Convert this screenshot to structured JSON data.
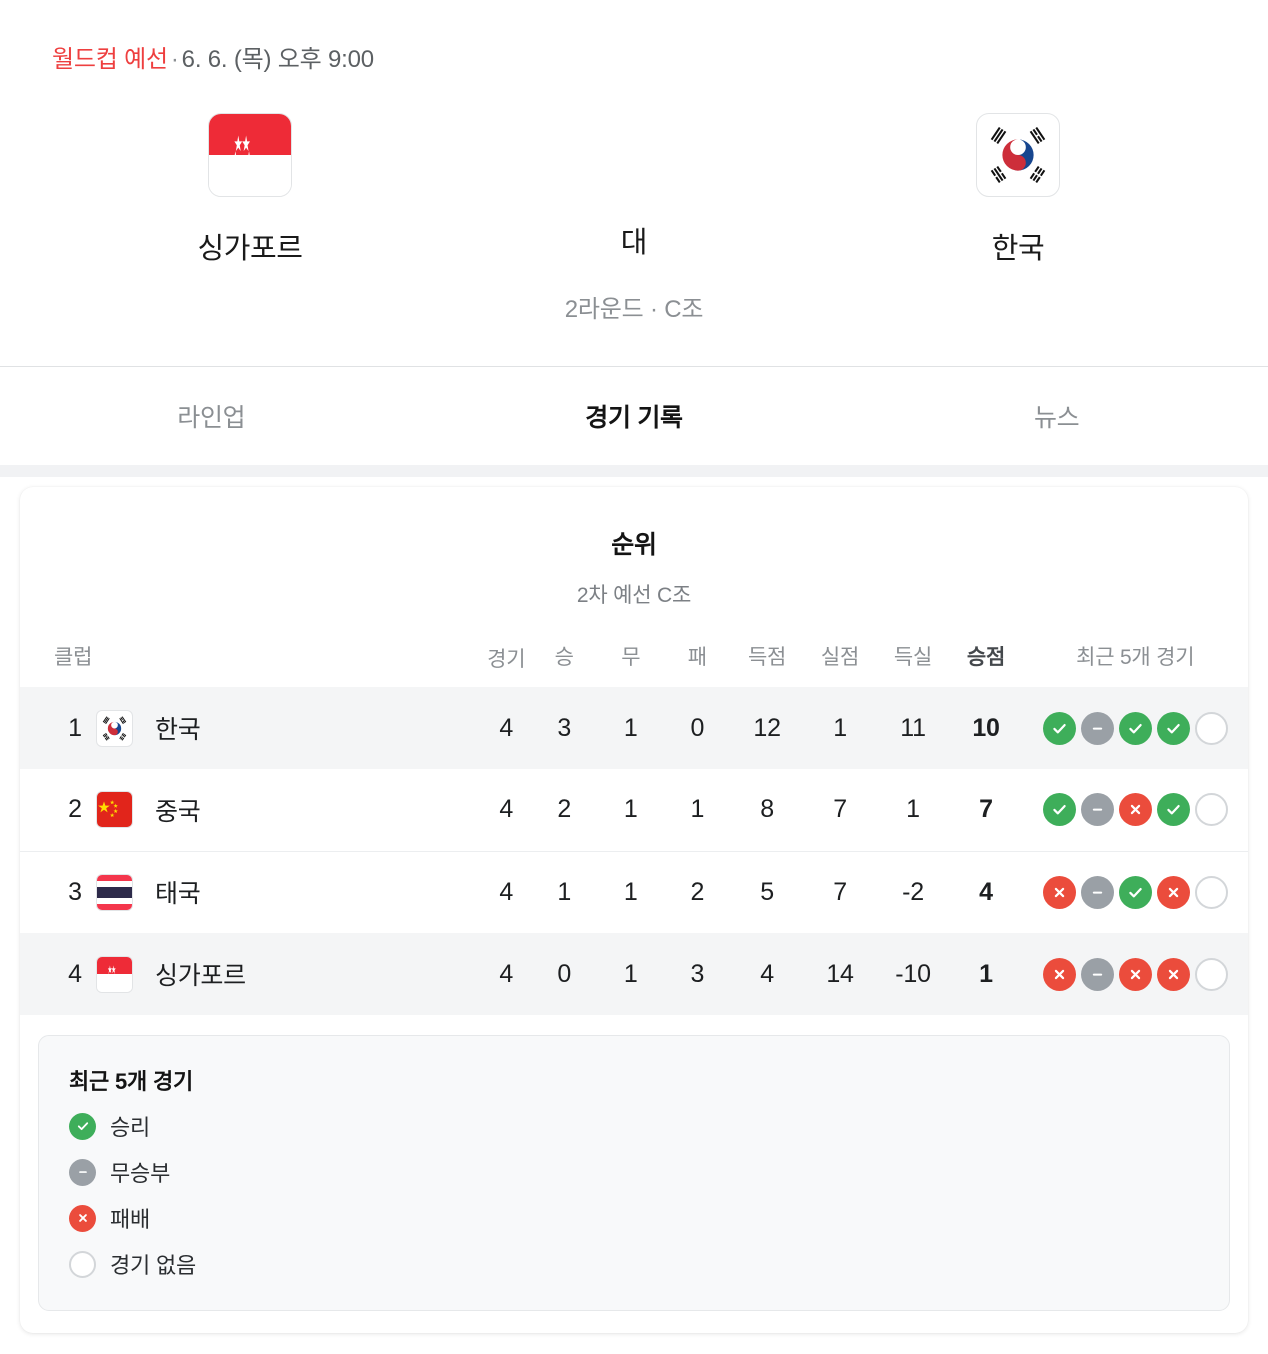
{
  "header": {
    "league": "월드컵 예선",
    "separator": "·",
    "datetime": "6. 6. (목) 오후 9:00",
    "home_team": "싱가포르",
    "away_team": "한국",
    "vs_label": "대",
    "round_label": "2라운드 · C조",
    "home_flag": "singapore-flag",
    "away_flag": "korea-flag"
  },
  "tabs": [
    {
      "label": "라인업",
      "active": false
    },
    {
      "label": "경기 기록",
      "active": true
    },
    {
      "label": "뉴스",
      "active": false
    }
  ],
  "standings": {
    "title": "순위",
    "subtitle": "2차 예선 C조",
    "columns": {
      "club": "클럽",
      "played": "경기",
      "win": "승",
      "draw": "무",
      "loss": "패",
      "goals_for": "득점",
      "goals_against": "실점",
      "goal_diff": "득실",
      "points": "승점",
      "form": "최근 5개 경기"
    },
    "rows": [
      {
        "rank": "1",
        "team": "한국",
        "flag": "korea-flag",
        "played": "4",
        "win": "3",
        "draw": "1",
        "loss": "0",
        "goals_for": "12",
        "goals_against": "1",
        "goal_diff": "11",
        "points": "10",
        "form": [
          "W",
          "D",
          "W",
          "W",
          "N"
        ],
        "highlight": true
      },
      {
        "rank": "2",
        "team": "중국",
        "flag": "china-flag",
        "played": "4",
        "win": "2",
        "draw": "1",
        "loss": "1",
        "goals_for": "8",
        "goals_against": "7",
        "goal_diff": "1",
        "points": "7",
        "form": [
          "W",
          "D",
          "L",
          "W",
          "N"
        ],
        "highlight": false
      },
      {
        "rank": "3",
        "team": "태국",
        "flag": "thailand-flag",
        "played": "4",
        "win": "1",
        "draw": "1",
        "loss": "2",
        "goals_for": "5",
        "goals_against": "7",
        "goal_diff": "-2",
        "points": "4",
        "form": [
          "L",
          "D",
          "W",
          "L",
          "N"
        ],
        "highlight": false
      },
      {
        "rank": "4",
        "team": "싱가포르",
        "flag": "singapore-flag",
        "played": "4",
        "win": "0",
        "draw": "1",
        "loss": "3",
        "goals_for": "4",
        "goals_against": "14",
        "goal_diff": "-10",
        "points": "1",
        "form": [
          "L",
          "D",
          "L",
          "L",
          "N"
        ],
        "highlight": true
      }
    ]
  },
  "legend": {
    "title": "최근 5개 경기",
    "items": [
      {
        "type": "W",
        "label": "승리"
      },
      {
        "type": "D",
        "label": "무승부"
      },
      {
        "type": "L",
        "label": "패배"
      },
      {
        "type": "N",
        "label": "경기 없음"
      }
    ]
  },
  "colors": {
    "league_red": "#ee3f3f",
    "win_green": "#3eae5a",
    "draw_gray": "#9aa0a6",
    "loss_red": "#eb4c3c",
    "none_border": "#d3d6d9",
    "row_highlight": "#f4f5f6"
  }
}
